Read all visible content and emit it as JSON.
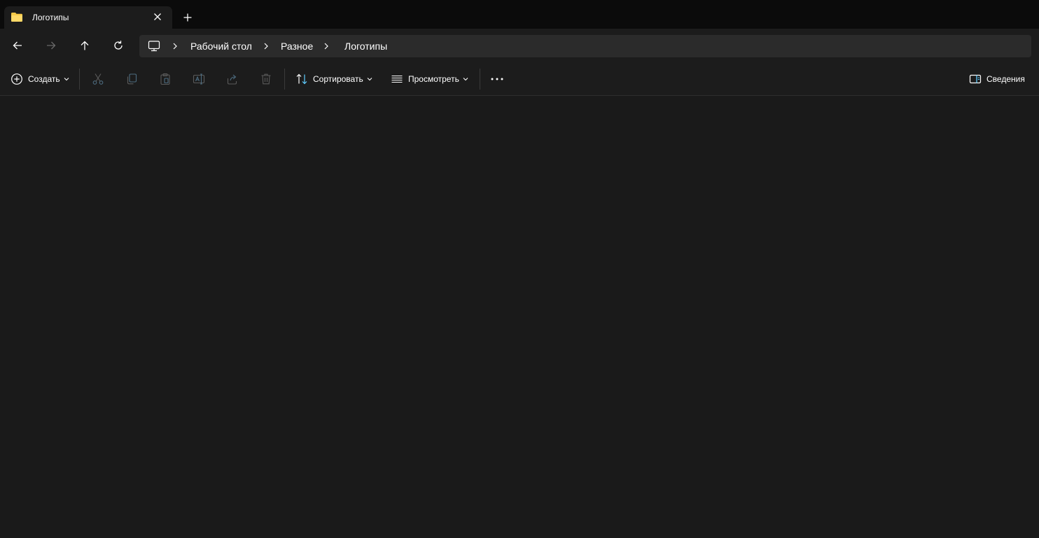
{
  "window": {
    "tab_title": "Логотипы",
    "tab_icon": "folder-icon",
    "colors": {
      "titlebar": "#0b0b0b",
      "surface": "#1c1c1c",
      "address": "#2b2b2b",
      "accent": "#60cdff",
      "folder": "#f7c948"
    }
  },
  "navigation": {
    "back_icon": "arrow-left-icon",
    "forward_icon": "arrow-right-icon",
    "up_icon": "arrow-up-icon",
    "refresh_icon": "refresh-icon",
    "breadcrumb": [
      "Рабочий стол",
      "Разное",
      "Логотипы"
    ]
  },
  "commandbar": {
    "new_label": "Создать",
    "sort_label": "Сортировать",
    "view_label": "Просмотреть",
    "details_label": "Сведения",
    "disabled_actions": [
      "cut",
      "copy",
      "paste",
      "rename",
      "share",
      "delete"
    ]
  }
}
